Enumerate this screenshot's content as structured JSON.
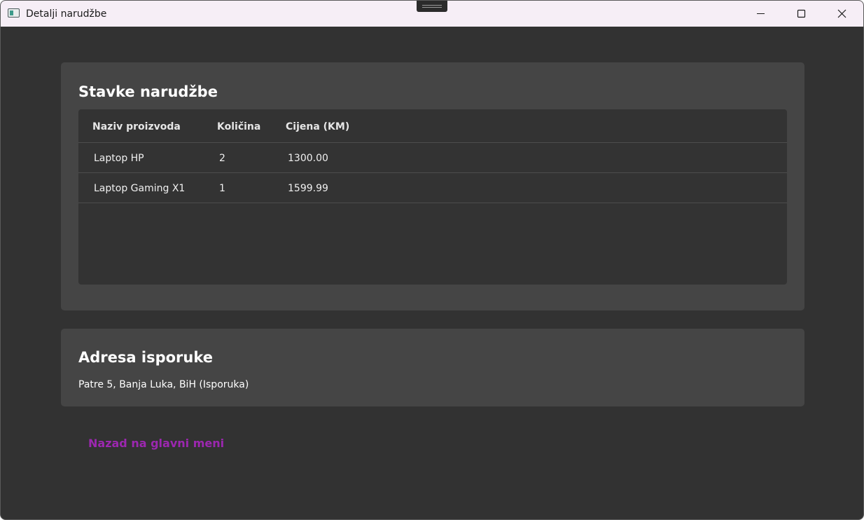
{
  "window": {
    "title": "Detalji narudžbe"
  },
  "items_section": {
    "title": "Stavke narudžbe",
    "columns": [
      "Naziv proizvoda",
      "Količina",
      "Cijena (KM)"
    ],
    "rows": [
      {
        "name": "Laptop HP",
        "quantity": "2",
        "price": "1300.00"
      },
      {
        "name": "Laptop Gaming X1",
        "quantity": "1",
        "price": "1599.99"
      }
    ]
  },
  "address_section": {
    "title": "Adresa isporuke",
    "address": "Patre 5, Banja Luka, BiH (Isporuka)"
  },
  "back_link": {
    "label": "Nazad na glavni meni"
  },
  "colors": {
    "background": "#323232",
    "card": "#454545",
    "accent": "#9c27b0",
    "titlebar": "#f6eef6"
  }
}
